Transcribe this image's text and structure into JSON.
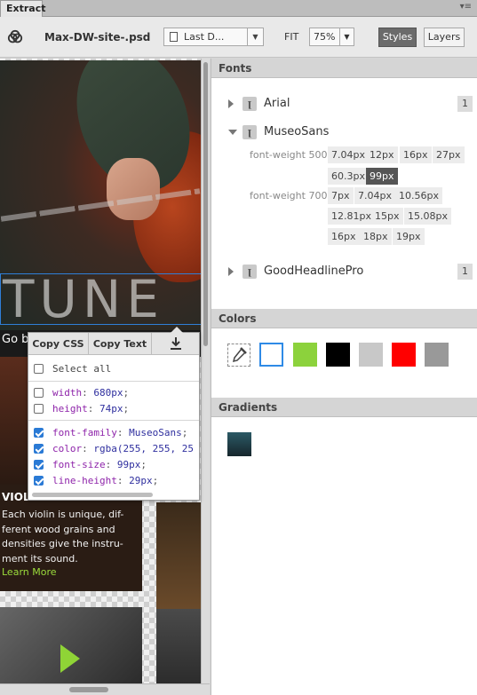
{
  "tab": {
    "title": "Extract",
    "menu_icon": "panel-menu-icon"
  },
  "toolbar": {
    "filename": "Max-DW-site-.psd",
    "state_select": "Last D...",
    "fit_label": "FIT",
    "zoom": "75%",
    "styles_label": "Styles",
    "layers_label": "Layers"
  },
  "canvas": {
    "hero_text": "TUNE",
    "hero_subtext": "Go b",
    "violin_title": "VIOL",
    "violin_desc_lines": [
      "Each violin is unique, dif-",
      "ferent wood grains and",
      "densities give the instru-",
      "ment its sound."
    ],
    "learn_more": "Learn More"
  },
  "popover": {
    "copy_css": "Copy CSS",
    "copy_text": "Copy Text",
    "download_icon": "download-icon",
    "select_all": "Select all",
    "props": [
      {
        "prop": "width",
        "value": "680px",
        "checked": false
      },
      {
        "prop": "height",
        "value": "74px",
        "checked": false
      },
      {
        "prop": "font-family",
        "value": "MuseoSans",
        "checked": true
      },
      {
        "prop": "color",
        "value": "rgba(255, 255, 25",
        "checked": true
      },
      {
        "prop": "font-size",
        "value": "99px",
        "checked": true
      },
      {
        "prop": "line-height",
        "value": "29px",
        "checked": true
      }
    ]
  },
  "fonts": {
    "header": "Fonts",
    "families": [
      {
        "name": "Arial",
        "count": "1"
      },
      {
        "name": "MuseoSans"
      },
      {
        "name": "GoodHeadlinePro",
        "count": "1"
      }
    ],
    "weight_500_label": "font-weight 500",
    "weight_500_sizes": [
      "7.04px",
      "12px",
      "16px",
      "27px",
      "60.3px",
      "99px"
    ],
    "weight_500_selected": "99px",
    "weight_700_label": "font-weight 700",
    "weight_700_sizes": [
      "7px",
      "7.04px",
      "10.56px",
      "12.81px",
      "15px",
      "15.08px",
      "16px",
      "18px",
      "19px"
    ]
  },
  "colors": {
    "header": "Colors",
    "eyedropper_icon": "eyedropper-icon",
    "swatches": [
      "#ffffff",
      "#8cd23c",
      "#000000",
      "#c8c8c8",
      "#ff0000",
      "#999999"
    ],
    "selected": "#ffffff"
  },
  "gradients": {
    "header": "Gradients",
    "swatch": [
      "#2c5a66",
      "#16262c"
    ]
  }
}
